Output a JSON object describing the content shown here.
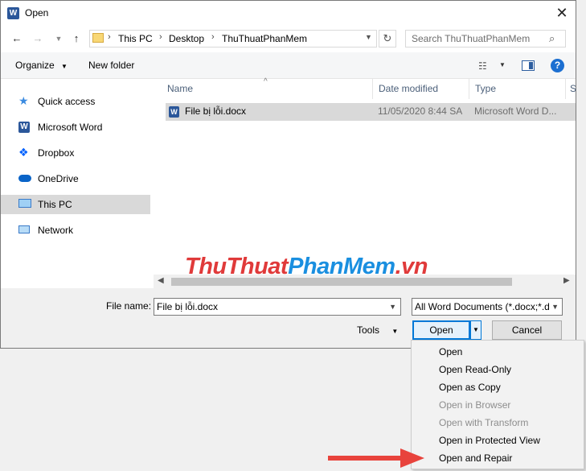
{
  "dialog": {
    "title": "Open",
    "close_icon": "close-icon"
  },
  "address": {
    "crumbs": [
      "This PC",
      "Desktop",
      "ThuThuatPhanMem"
    ]
  },
  "search": {
    "placeholder": "Search ThuThuatPhanMem"
  },
  "toolbar": {
    "organize": "Organize",
    "new_folder": "New folder"
  },
  "nav": {
    "items": [
      {
        "label": "Quick access",
        "icon": "star-icon"
      },
      {
        "label": "Microsoft Word",
        "icon": "word-icon"
      },
      {
        "label": "Dropbox",
        "icon": "dropbox-icon"
      },
      {
        "label": "OneDrive",
        "icon": "cloud-icon"
      },
      {
        "label": "This PC",
        "icon": "computer-icon"
      },
      {
        "label": "Network",
        "icon": "network-icon"
      }
    ]
  },
  "columns": [
    "Name",
    "Date modified",
    "Type",
    "S"
  ],
  "files": [
    {
      "name": "File bị lỗi.docx",
      "date": "11/05/2020 8:44 SA",
      "type": "Microsoft Word D..."
    }
  ],
  "watermark": {
    "part1": "ThuThuat",
    "part2": "PhanMem",
    "part3": ".vn"
  },
  "bottom": {
    "filename_label": "File name:",
    "filename_value": "File bị lỗi.docx",
    "filetype_value": "All Word Documents (*.docx;*.d",
    "tools": "Tools",
    "open": "Open",
    "cancel": "Cancel"
  },
  "menu": {
    "items": [
      {
        "label": "Open",
        "disabled": false
      },
      {
        "label": "Open Read-Only",
        "disabled": false
      },
      {
        "label": "Open as Copy",
        "disabled": false
      },
      {
        "label": "Open in Browser",
        "disabled": true
      },
      {
        "label": "Open with Transform",
        "disabled": true
      },
      {
        "label": "Open in Protected View",
        "disabled": false
      },
      {
        "label": "Open and Repair",
        "disabled": false
      }
    ]
  },
  "colors": {
    "accent": "#0078d7",
    "arrow": "#e8433c",
    "selection": "#d9d9d9",
    "watermark_red": "#e03a3a",
    "watermark_blue": "#1a8fe0"
  }
}
